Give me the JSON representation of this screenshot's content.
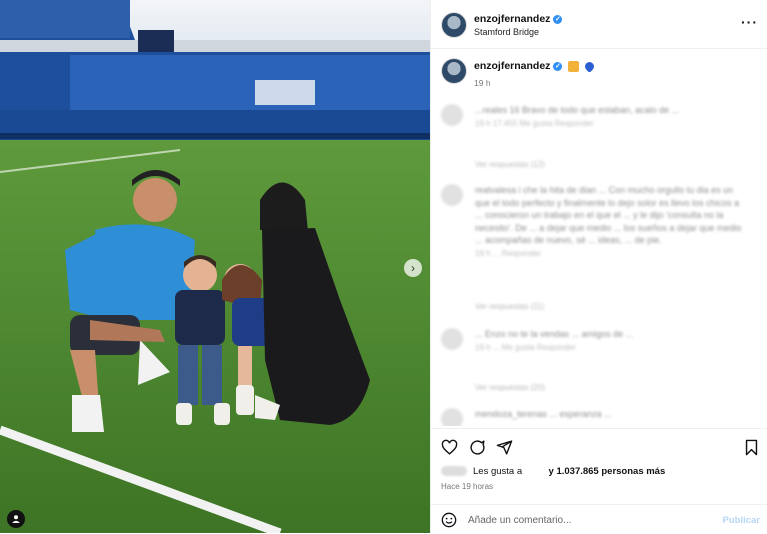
{
  "post": {
    "author": "enzojfernandez",
    "location": "Stamford Bridge",
    "time_ago": "19 h",
    "verified_mark": "✓"
  },
  "comments": [
    {
      "text": "...reales 16 Bravo de todo que estaban, acalo de ...",
      "meta": "19 h  17.455 Me gusta  Responder"
    },
    {
      "text": "realvalesa i che la hita de dian ... Con mucho orgullo tu dia es un que el todo perfecto y finalmente lo dejo solor es llevo los chicos a ... conocieron un trabajo en el que el ... y le dijo 'consulta no la necesito'. De ... a dejar que medio ... los sueños a dejar que medio ... acompañas de nuevo, sé ... ideas, ... de pie.",
      "meta": "19 h  ...  Responder"
    },
    {
      "text": "... Enzo no te la vendas ... amigos de ...",
      "meta": "19 h  ... Me gusta  Responder"
    },
    {
      "text": "mendoza_terenas ... esperanza ...",
      "meta": ""
    }
  ],
  "replies": [
    "Ver respuestas (12)",
    "Ver respuestas (11)",
    "Ver respuestas (20)"
  ],
  "likes": {
    "prefix": "Les gusta a",
    "suffix": "y 1.037.865 personas más"
  },
  "posted_ago": "Hace 19 horas",
  "add_comment": {
    "placeholder": "Añade un comentario...",
    "publish_label": "Publicar"
  },
  "colors": {
    "accent": "#2f8ff5",
    "publish": "#b8d6f7"
  },
  "icons": [
    "more-icon",
    "heart-icon",
    "comment-icon",
    "share-icon",
    "bookmark-icon",
    "emoji-icon",
    "chevron-right-icon",
    "user-tag-icon"
  ]
}
